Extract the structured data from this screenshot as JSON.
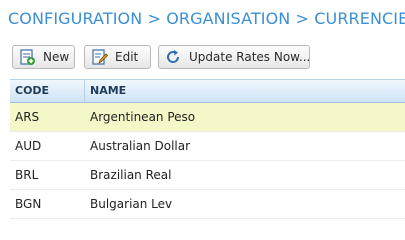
{
  "breadcrumb": {
    "items": [
      "CONFIGURATION",
      "ORGANISATION",
      "CURRENCIES"
    ],
    "separator": ">",
    "color": "#3b8fd4"
  },
  "toolbar": {
    "new_label": "New",
    "edit_label": "Edit",
    "update_label": "Update Rates Now..."
  },
  "grid": {
    "columns": [
      "CODE",
      "NAME"
    ],
    "rows": [
      {
        "code": "ARS",
        "name": "Argentinean Peso",
        "selected": true
      },
      {
        "code": "AUD",
        "name": "Australian Dollar",
        "selected": false
      },
      {
        "code": "BRL",
        "name": "Brazilian Real",
        "selected": false
      },
      {
        "code": "BGN",
        "name": "Bulgarian Lev",
        "selected": false
      }
    ],
    "selected_color": "#f6f7c9"
  }
}
